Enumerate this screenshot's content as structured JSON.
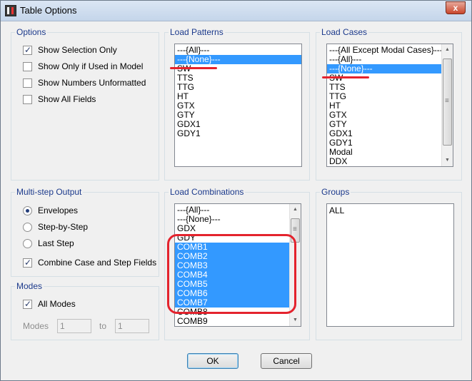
{
  "window": {
    "title": "Table Options",
    "close_glyph": "x"
  },
  "options": {
    "label": "Options",
    "items": [
      {
        "label": "Show Selection Only",
        "checked": true
      },
      {
        "label": "Show Only if Used in Model",
        "checked": false
      },
      {
        "label": "Show Numbers Unformatted",
        "checked": false
      },
      {
        "label": "Show All Fields",
        "checked": false
      }
    ]
  },
  "load_patterns": {
    "label": "Load Patterns",
    "items": [
      "---{All}---",
      "---{None}---",
      "SW",
      "TTS",
      "TTG",
      "HT",
      "GTX",
      "GTY",
      "GDX1",
      "GDY1"
    ],
    "selected": [
      1
    ]
  },
  "load_cases": {
    "label": "Load Cases",
    "items": [
      "---{All Except Modal Cases}---",
      "---{All}---",
      "---{None}---",
      "SW",
      "TTS",
      "TTG",
      "HT",
      "GTX",
      "GTY",
      "GDX1",
      "GDY1",
      "Modal",
      "DDX"
    ],
    "selected": [
      2
    ]
  },
  "multistep": {
    "label": "Multi-step Output",
    "radios": [
      {
        "label": "Envelopes",
        "selected": true
      },
      {
        "label": "Step-by-Step",
        "selected": false
      },
      {
        "label": "Last Step",
        "selected": false
      }
    ],
    "combine": {
      "label": "Combine Case and Step Fields",
      "checked": true
    }
  },
  "load_combinations": {
    "label": "Load Combinations",
    "items": [
      "---{All}---",
      "---{None}---",
      "GDX",
      "GDY",
      "COMB1",
      "COMB2",
      "COMB3",
      "COMB4",
      "COMB5",
      "COMB6",
      "COMB7",
      "COMB8",
      "COMB9"
    ],
    "selected": [
      4,
      5,
      6,
      7,
      8,
      9,
      10
    ]
  },
  "groups": {
    "label": "Groups",
    "items": [
      "ALL"
    ]
  },
  "modes": {
    "label": "Modes",
    "all_modes": {
      "label": "All Modes",
      "checked": true
    },
    "from_label": "Modes",
    "from_value": "1",
    "to_label": "to",
    "to_value": "1"
  },
  "buttons": {
    "ok": "OK",
    "cancel": "Cancel"
  },
  "colors": {
    "selection": "#3399ff",
    "group_label": "#1c3a8c",
    "annotation": "#e4232d"
  }
}
